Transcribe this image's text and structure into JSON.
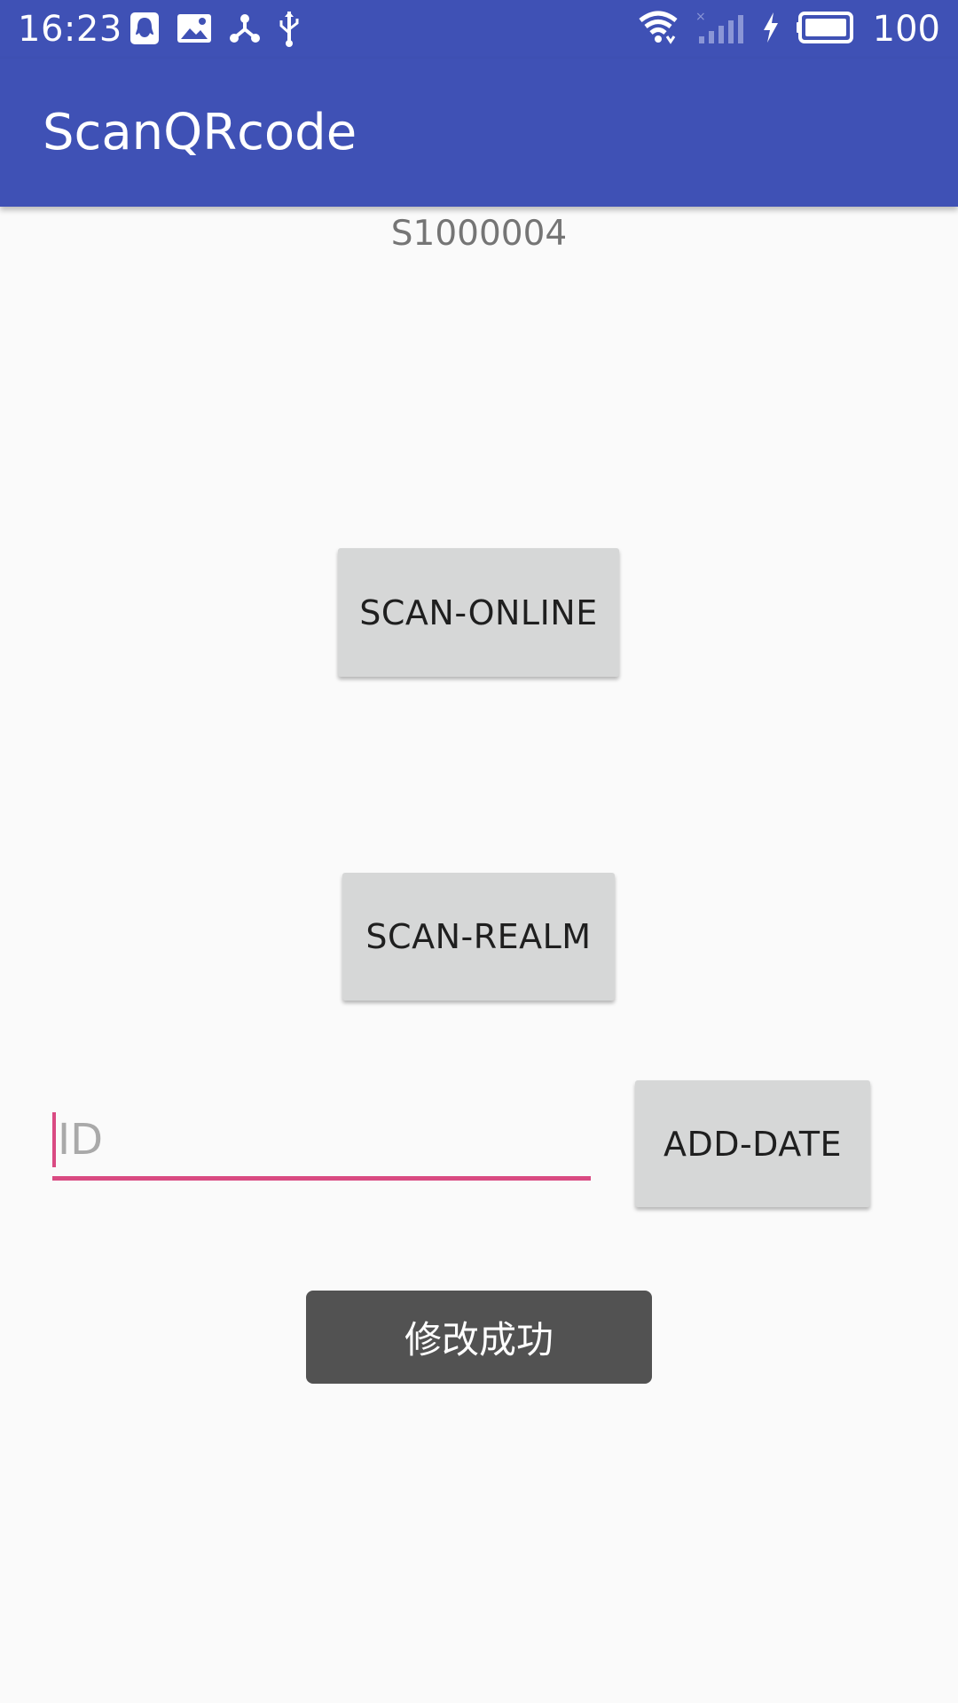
{
  "status_bar": {
    "time": "16:23",
    "icons": [
      "qq-icon",
      "image-icon",
      "share-icon",
      "usb-icon"
    ],
    "right_icons": [
      "wifi-icon",
      "signal-icon",
      "charging-icon",
      "battery-icon"
    ],
    "battery_level": "100"
  },
  "app_bar": {
    "title": "ScanQRcode",
    "color": "#3f51b5"
  },
  "main": {
    "code": "S1000004",
    "scan_online_label": "SCAN-ONLINE",
    "scan_realm_label": "SCAN-REALM",
    "id_placeholder": "ID",
    "add_date_label": "ADD-DATE",
    "accent_color": "#d94a82"
  },
  "toast": {
    "message": "修改成功"
  }
}
